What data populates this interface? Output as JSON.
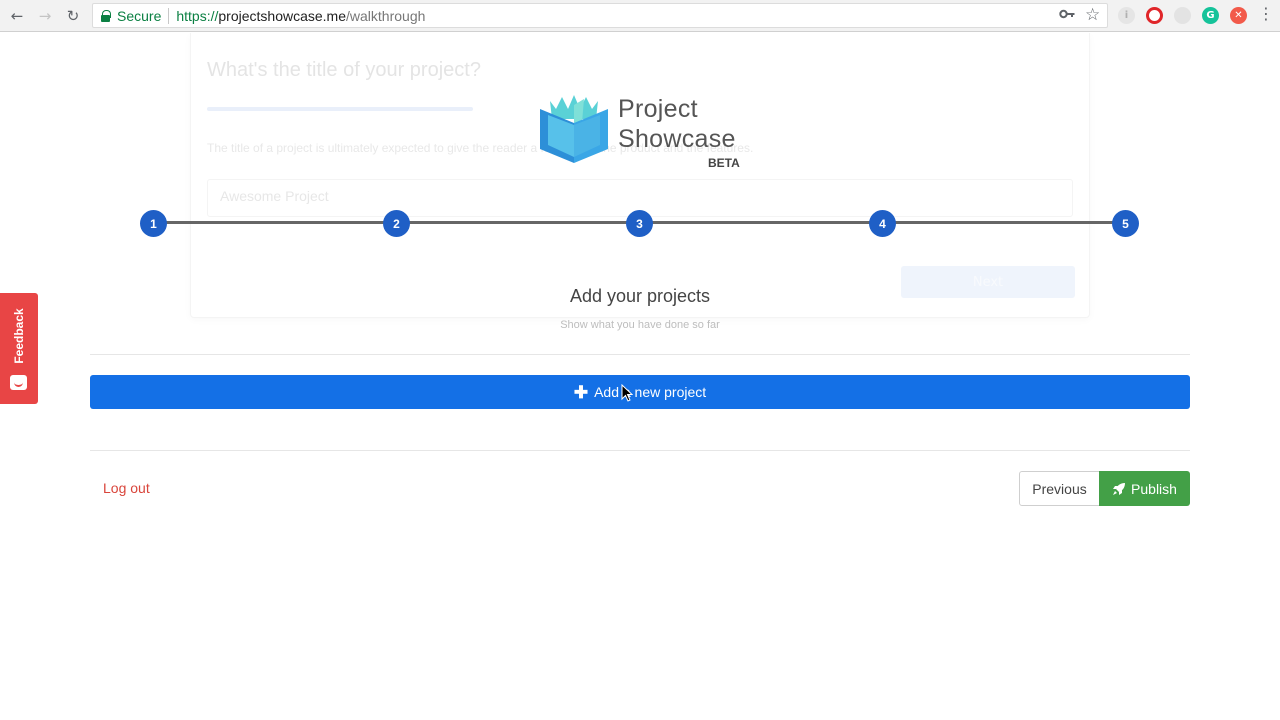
{
  "browser": {
    "secure_label": "Secure",
    "url_scheme": "https://",
    "url_host": "projectshowcase.me",
    "url_path": "/walkthrough",
    "back_icon": "←",
    "forward_icon": "→",
    "reload_icon": "↻",
    "key_icon": "key-icon",
    "star_icon": "☆",
    "menu_icon": "⋮"
  },
  "ghost_form": {
    "question": "What's the title of your project?",
    "help_text": "The title of a project is ultimately expected to give the reader a full view of the product and the features.",
    "input_placeholder": "Awesome Project",
    "next_label": "Next"
  },
  "logo": {
    "line1": "Project",
    "line2": "Showcase",
    "badge": "BETA"
  },
  "stepper": {
    "steps": [
      "1",
      "2",
      "3",
      "4",
      "5"
    ]
  },
  "section": {
    "title": "Add your projects",
    "subtitle": "Show what you have done so far"
  },
  "actions": {
    "add_project_label": "Add a new project",
    "logout_label": "Log out",
    "previous_label": "Previous",
    "publish_label": "Publish"
  },
  "feedback": {
    "label": "Feedback"
  },
  "colors": {
    "primary": "#1470e6",
    "step": "#1f5fc6",
    "publish": "#43a047",
    "logout": "#d9453b",
    "feedback": "#e84545"
  }
}
